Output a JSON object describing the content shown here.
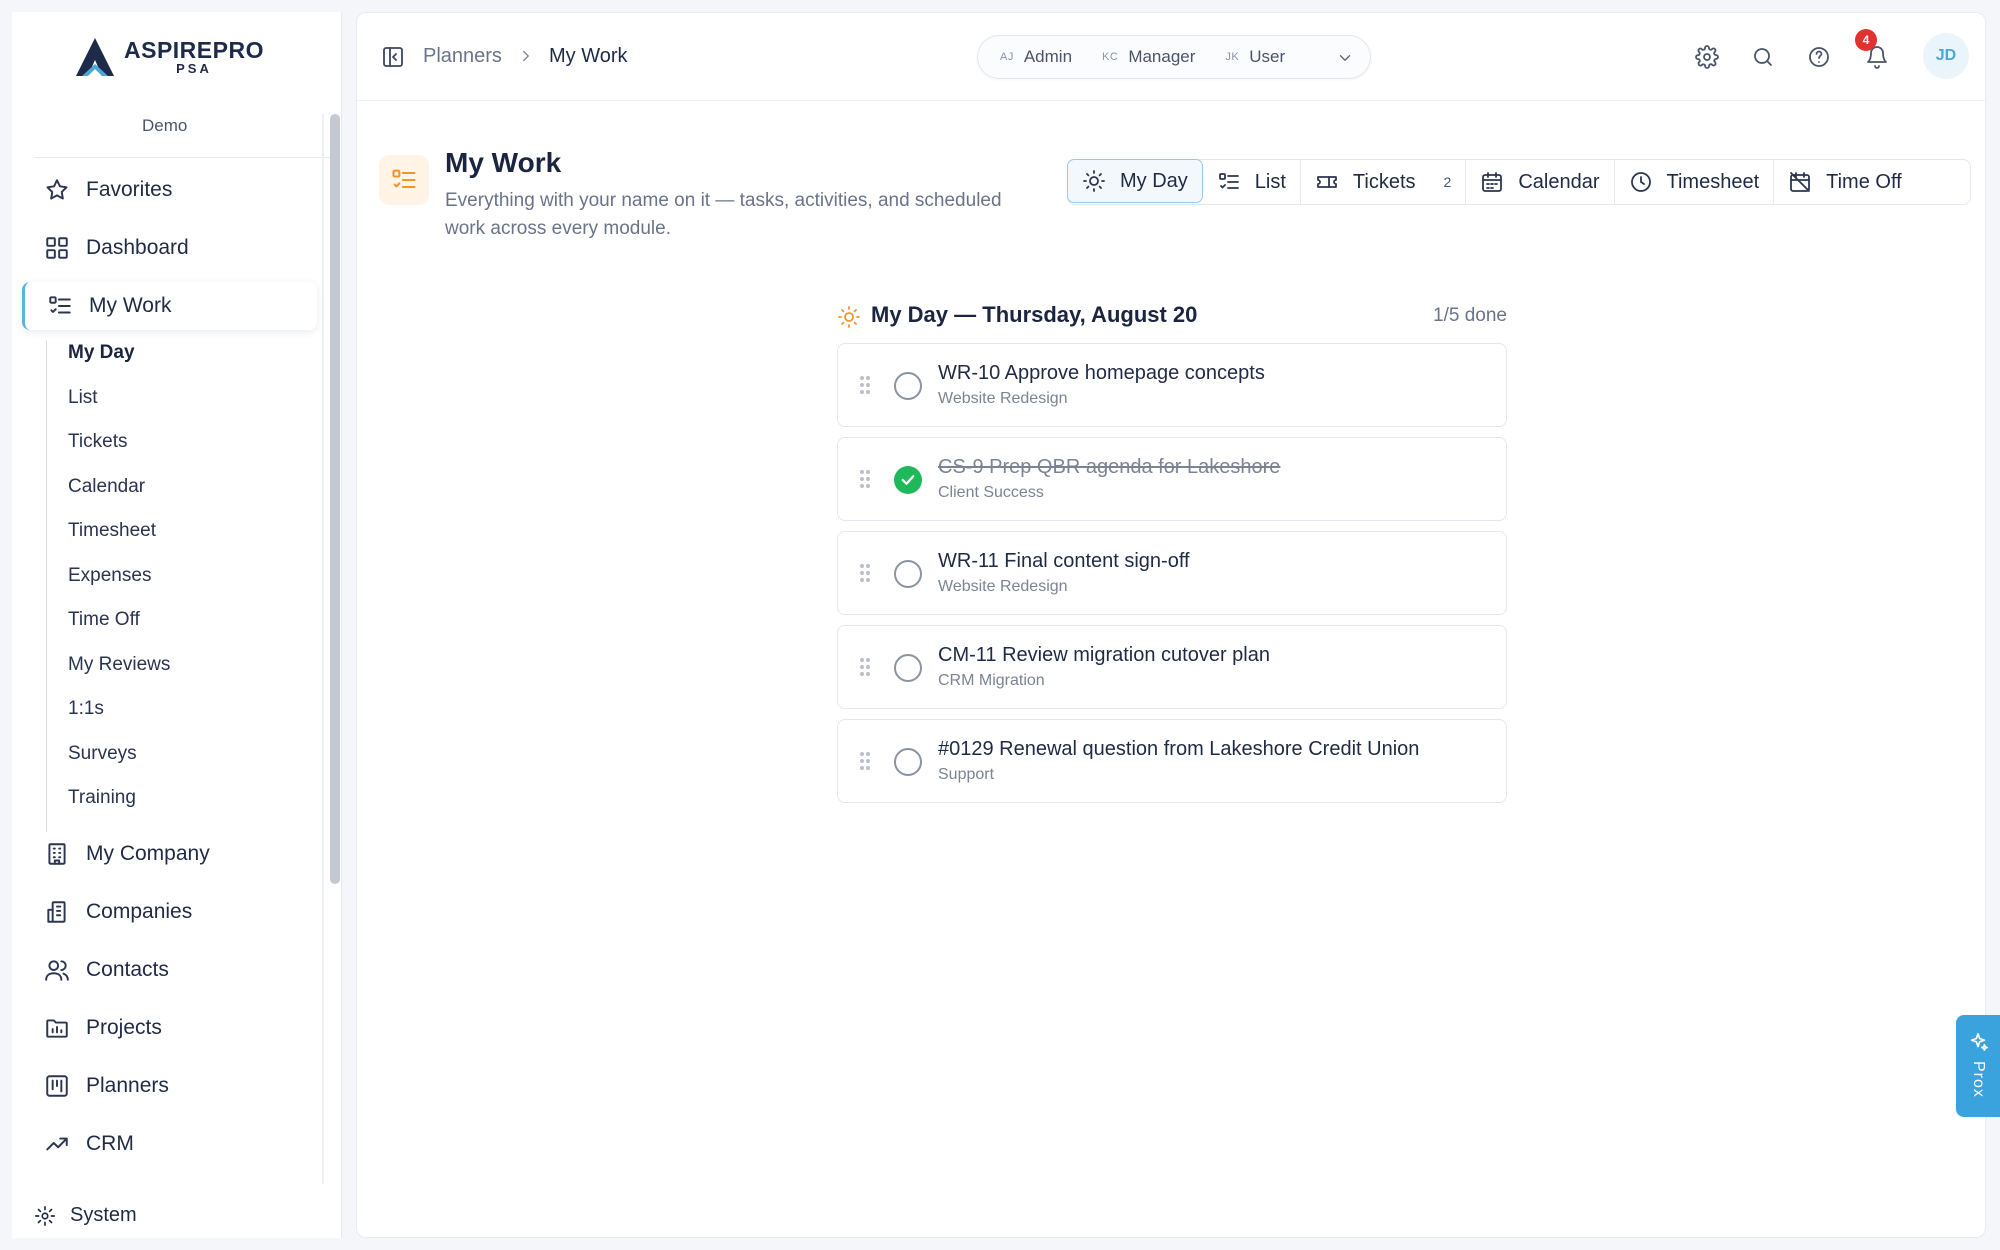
{
  "brand": {
    "name": "ASPIREPRO",
    "sub": "PSA",
    "tenant": "Demo",
    "accent": "#5ab3dd"
  },
  "nav": {
    "favorites": "Favorites",
    "dashboard": "Dashboard",
    "my_work": "My Work",
    "my_work_sub": [
      "My Day",
      "List",
      "Tickets",
      "Calendar",
      "Timesheet",
      "Expenses",
      "Time Off",
      "My Reviews",
      "1:1s",
      "Surveys",
      "Training"
    ],
    "my_company": "My Company",
    "companies": "Companies",
    "contacts": "Contacts",
    "projects": "Projects",
    "planners": "Planners",
    "crm": "CRM",
    "system": "System"
  },
  "breadcrumb": {
    "parent": "Planners",
    "current": "My Work"
  },
  "roles": [
    {
      "initials": "AJ",
      "name": "Admin"
    },
    {
      "initials": "KC",
      "name": "Manager"
    },
    {
      "initials": "JK",
      "name": "User"
    }
  ],
  "header": {
    "notifications": "4",
    "avatar": "JD"
  },
  "page": {
    "title": "My Work",
    "subtitle": "Everything with your name on it — tasks, activities, and scheduled work across every module."
  },
  "tabs": [
    {
      "label": "My Day",
      "icon": "sun-icon"
    },
    {
      "label": "List",
      "icon": "list-icon"
    },
    {
      "label": "Tickets",
      "icon": "ticket-icon",
      "count": "2"
    },
    {
      "label": "Calendar",
      "icon": "calendar-icon"
    },
    {
      "label": "Timesheet",
      "icon": "clock-icon"
    },
    {
      "label": "Time Off",
      "icon": "calendar-off-icon"
    }
  ],
  "my_day": {
    "title": "My Day — Thursday, August 20",
    "progress": "1/5 done",
    "tasks": [
      {
        "title": "WR-10 Approve homepage concepts",
        "project": "Website Redesign",
        "done": false
      },
      {
        "title": "CS-9 Prep QBR agenda for Lakeshore",
        "project": "Client Success",
        "done": true
      },
      {
        "title": "WR-11 Final content sign-off",
        "project": "Website Redesign",
        "done": false
      },
      {
        "title": "CM-11 Review migration cutover plan",
        "project": "CRM Migration",
        "done": false
      },
      {
        "title": "#0129 Renewal question from Lakeshore Credit Union",
        "project": "Support",
        "done": false
      }
    ]
  },
  "assistant": {
    "label": "Prox"
  }
}
